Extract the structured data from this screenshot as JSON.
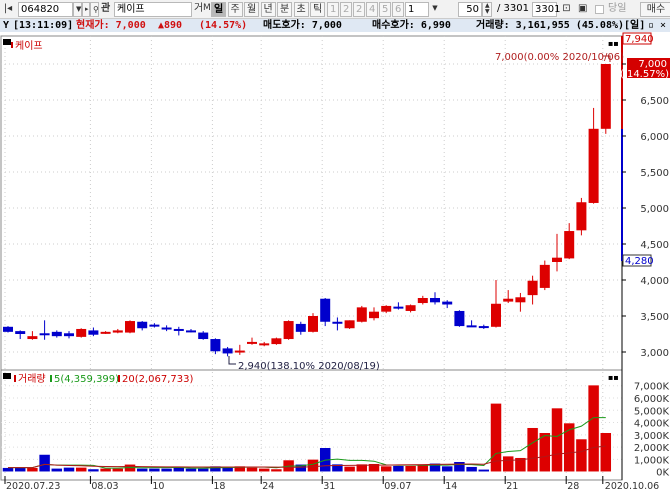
{
  "toolbar": {
    "code": "064820",
    "name": "케이프",
    "btn_gwan": "관",
    "btn_ge": "거",
    "btn_m": "M",
    "periods": [
      "일",
      "주",
      "월",
      "년",
      "분",
      "초",
      "틱"
    ],
    "selected_period": "일",
    "numbers": [
      "1",
      "2",
      "2",
      "4",
      "5",
      "6"
    ],
    "multiplier": "1",
    "count": "50",
    "total_sep": "/ 3301",
    "total": "3301",
    "today_label": "당일",
    "buy_label": "매수"
  },
  "info": {
    "time": "[13:11:09]",
    "current_label": "현재가: 7,000",
    "change": "▲890",
    "change_pct": "(14.57%)",
    "ask": "매도호가: 7,000",
    "bid": "매수호가: 6,990",
    "volume": "거래량: 3,161,955 (45.08%)",
    "period_tag": "[일]"
  },
  "price_panel": {
    "title": "케이프",
    "upper_limit": "7,940",
    "lower_limit": "4,280",
    "current_price": "7,000",
    "current_pct": "( 14.57%)",
    "high_note": "7,000(0.00% 2020/10/06)",
    "low_note": "2,940(138.10% 2020/08/19)",
    "axis_labels": [
      "7,000",
      "6,500",
      "6,000",
      "5,500",
      "5,000",
      "4,500",
      "4,000",
      "3,500",
      "3,000"
    ]
  },
  "volume_panel": {
    "title": "거래량",
    "ma5": "5(4,359,399)",
    "ma20": "20(2,067,733)",
    "axis_labels": [
      "7,000K",
      "6,000K",
      "5,000K",
      "4,000K",
      "3,000K",
      "2,000K",
      "1,000K",
      "0K"
    ]
  },
  "dates": [
    {
      "i": 0,
      "label": "2020.07.23"
    },
    {
      "i": 7,
      "label": "08.03"
    },
    {
      "i": 12,
      "label": "10"
    },
    {
      "i": 17,
      "label": "18"
    },
    {
      "i": 21,
      "label": "24"
    },
    {
      "i": 26,
      "label": "31"
    },
    {
      "i": 31,
      "label": "09.07"
    },
    {
      "i": 36,
      "label": "14"
    },
    {
      "i": 41,
      "label": "21"
    },
    {
      "i": 46,
      "label": "28"
    },
    {
      "i": 49,
      "label": "2020.10.06"
    }
  ],
  "colors": {
    "up": "#dd0000",
    "down": "#0000cc",
    "ma5": "#1a9a1a",
    "ma20": "#b01818"
  },
  "chart_data": {
    "type": "candlestick",
    "x_count": 50,
    "ylim": [
      2800,
      7100
    ],
    "vol_ylim": [
      0,
      7000000
    ],
    "ohlc": [
      [
        3350,
        3360,
        3270,
        3280
      ],
      [
        3290,
        3300,
        3180,
        3250
      ],
      [
        3180,
        3290,
        3170,
        3220
      ],
      [
        3260,
        3440,
        3170,
        3250
      ],
      [
        3280,
        3300,
        3200,
        3220
      ],
      [
        3260,
        3290,
        3190,
        3220
      ],
      [
        3210,
        3330,
        3200,
        3320
      ],
      [
        3300,
        3340,
        3220,
        3240
      ],
      [
        3260,
        3290,
        3250,
        3280
      ],
      [
        3270,
        3320,
        3260,
        3300
      ],
      [
        3270,
        3440,
        3260,
        3430
      ],
      [
        3420,
        3430,
        3300,
        3330
      ],
      [
        3380,
        3400,
        3340,
        3370
      ],
      [
        3340,
        3370,
        3290,
        3330
      ],
      [
        3320,
        3350,
        3230,
        3310
      ],
      [
        3300,
        3320,
        3270,
        3290
      ],
      [
        3270,
        3290,
        3170,
        3180
      ],
      [
        3180,
        3190,
        2970,
        3010
      ],
      [
        3050,
        3070,
        2940,
        2980
      ],
      [
        3000,
        3100,
        2960,
        3020
      ],
      [
        3120,
        3200,
        3100,
        3140
      ],
      [
        3100,
        3140,
        3080,
        3120
      ],
      [
        3110,
        3200,
        3100,
        3190
      ],
      [
        3180,
        3440,
        3170,
        3430
      ],
      [
        3390,
        3420,
        3240,
        3280
      ],
      [
        3280,
        3540,
        3270,
        3500
      ],
      [
        3740,
        3750,
        3360,
        3420
      ],
      [
        3420,
        3480,
        3300,
        3400
      ],
      [
        3330,
        3440,
        3320,
        3440
      ],
      [
        3420,
        3640,
        3410,
        3620
      ],
      [
        3470,
        3620,
        3440,
        3560
      ],
      [
        3560,
        3650,
        3540,
        3640
      ],
      [
        3630,
        3690,
        3590,
        3620
      ],
      [
        3570,
        3660,
        3550,
        3650
      ],
      [
        3680,
        3780,
        3660,
        3750
      ],
      [
        3750,
        3830,
        3660,
        3690
      ],
      [
        3700,
        3720,
        3610,
        3660
      ],
      [
        3570,
        3580,
        3350,
        3360
      ],
      [
        3370,
        3440,
        3350,
        3360
      ],
      [
        3360,
        3380,
        3320,
        3355
      ],
      [
        3350,
        4000,
        3340,
        3670
      ],
      [
        3700,
        3860,
        3680,
        3740
      ],
      [
        3690,
        3820,
        3560,
        3760
      ],
      [
        3790,
        4060,
        3660,
        3990
      ],
      [
        3890,
        4270,
        3860,
        4210
      ],
      [
        4250,
        4640,
        4120,
        4310
      ],
      [
        4300,
        4790,
        4290,
        4680
      ],
      [
        4690,
        5140,
        4620,
        5080
      ],
      [
        5070,
        6390,
        5060,
        6100
      ],
      [
        6100,
        7000,
        6030,
        7000
      ]
    ],
    "volume": [
      330000,
      330000,
      330000,
      1400000,
      270000,
      350000,
      350000,
      220000,
      270000,
      270000,
      600000,
      270000,
      270000,
      270000,
      350000,
      270000,
      270000,
      460000,
      330000,
      460000,
      350000,
      270000,
      220000,
      950000,
      600000,
      1000000,
      1950000,
      620000,
      430000,
      620000,
      650000,
      460000,
      490000,
      490000,
      540000,
      680000,
      460000,
      810000,
      410000,
      190000,
      5560000,
      1270000,
      1140000,
      3580000,
      3170000,
      5180000,
      3960000,
      2660000,
      7050000,
      3170000
    ]
  }
}
